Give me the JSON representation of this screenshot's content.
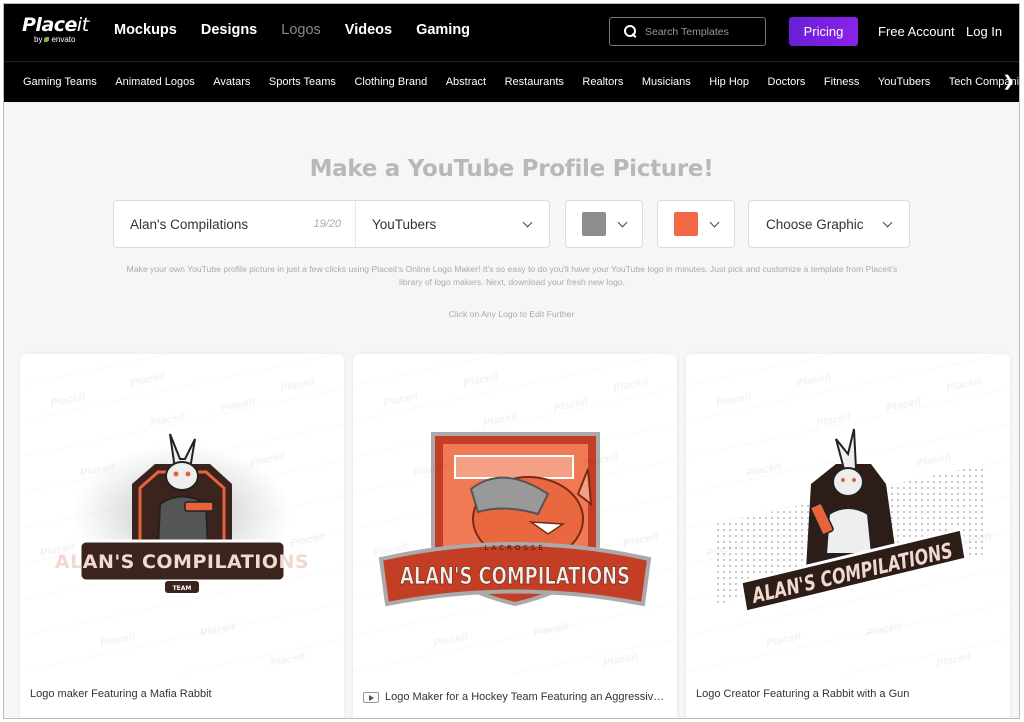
{
  "brand": {
    "name_bold": "Place",
    "name_light": "it",
    "byline": "by",
    "parent": "envato"
  },
  "main_nav": [
    {
      "label": "Mockups",
      "active": false
    },
    {
      "label": "Designs",
      "active": false
    },
    {
      "label": "Logos",
      "active": true
    },
    {
      "label": "Videos",
      "active": false
    },
    {
      "label": "Gaming",
      "active": false
    }
  ],
  "search": {
    "placeholder": "Search Templates",
    "icon": "search-icon"
  },
  "header_actions": {
    "pricing": "Pricing",
    "free_account": "Free Account",
    "login": "Log In"
  },
  "categories": [
    "Gaming Teams",
    "Animated Logos",
    "Avatars",
    "Sports Teams",
    "Clothing Brand",
    "Abstract",
    "Restaurants",
    "Realtors",
    "Musicians",
    "Hip Hop",
    "Doctors",
    "Fitness",
    "YouTubers",
    "Tech Companies"
  ],
  "category_next_icon": "chevron-right-icon",
  "page": {
    "headline": "Make a YouTube Profile Picture!",
    "description": "Make your own YouTube profile picture in just a few clicks using Placeit's Online Logo Maker! It's so easy to do you'll have your YouTube logo in minutes. Just pick and customize a template from Placeit's library of logo makers. Next, download your fresh new logo.",
    "hint": "Click on Any Logo to Edit Further"
  },
  "controls": {
    "name_value": "Alan's Compilations",
    "name_count": "19/20",
    "industry_selected": "YouTubers",
    "color1": "#8e8e8e",
    "color2": "#f26a45",
    "graphic_label": "Choose Graphic"
  },
  "watermark": "Placeit",
  "cards": [
    {
      "caption": "Logo maker Featuring a Mafia Rabbit",
      "video": false,
      "logo_text": "ALAN'S COMPILATIONS",
      "logo_sub": "TEAM"
    },
    {
      "caption": "Logo Maker for a Hockey Team Featuring an Aggressive Rhino",
      "video": true,
      "logo_text": "ALAN'S COMPILATIONS",
      "logo_sub": "LACROSSE"
    },
    {
      "caption": "Logo Creator Featuring a Rabbit with a Gun",
      "video": false,
      "logo_text": "ALAN'S COMPILATIONS",
      "logo_sub": ""
    }
  ]
}
